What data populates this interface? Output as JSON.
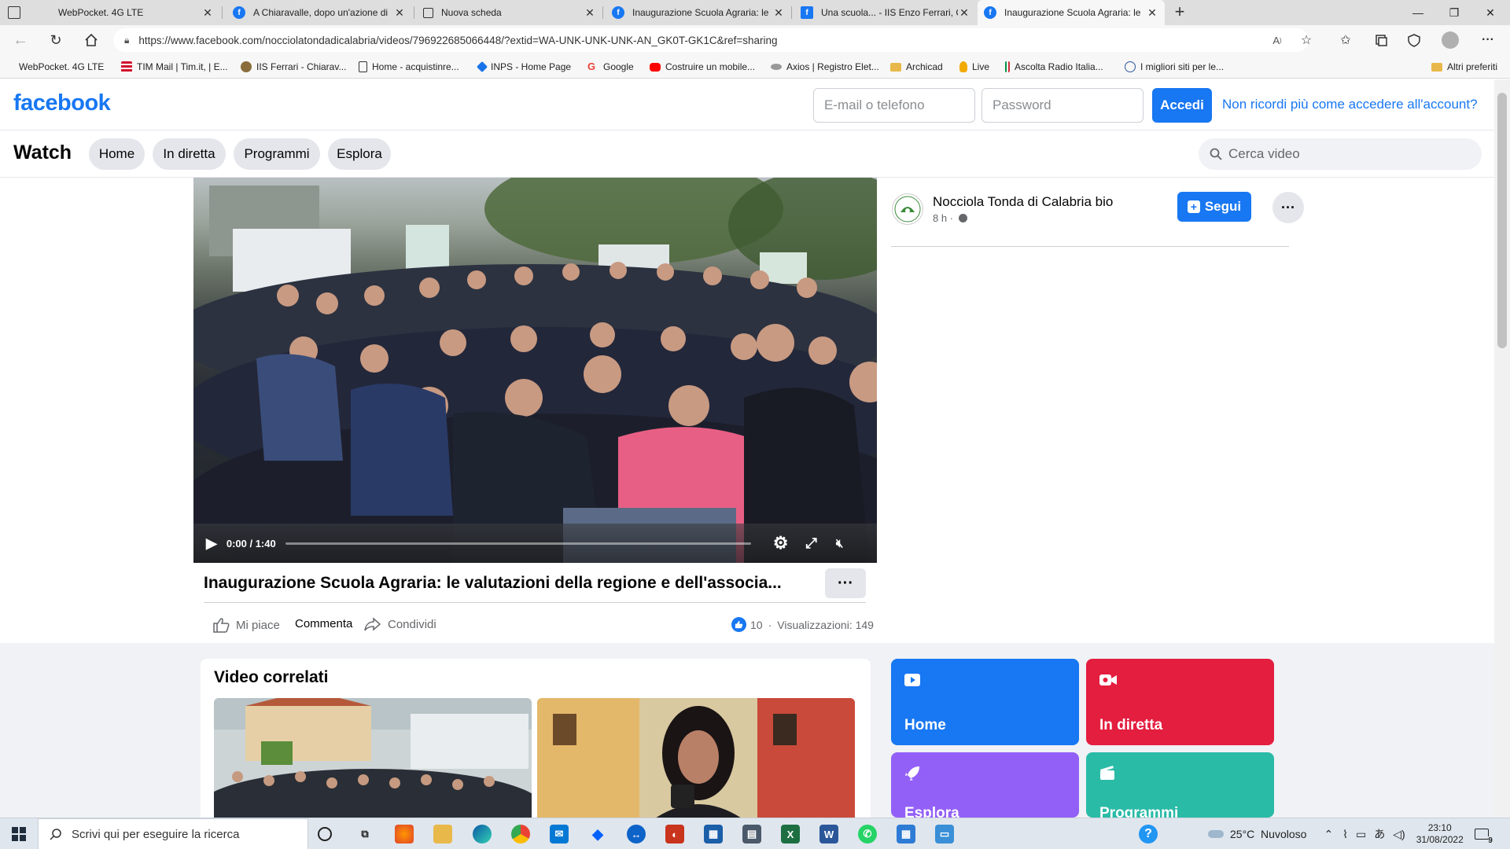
{
  "browser": {
    "tabs": [
      {
        "title": "WebPocket. 4G LTE",
        "favicon": "webpocket-icon",
        "active": false
      },
      {
        "title": "A Chiaravalle, dopo un'azione di",
        "favicon": "facebook-icon",
        "active": false
      },
      {
        "title": "Nuova scheda",
        "favicon": "new-tab-icon",
        "active": false
      },
      {
        "title": "Inaugurazione Scuola Agraria: le",
        "favicon": "facebook-icon",
        "active": false
      },
      {
        "title": "Una scuola... - IIS Enzo Ferrari, Ch",
        "favicon": "facebook-square-icon",
        "active": false
      },
      {
        "title": "Inaugurazione Scuola Agraria: le",
        "favicon": "facebook-icon",
        "active": true
      }
    ],
    "url": "https://www.facebook.com/nocciolatondadicalabria/videos/796922685066448/?extid=WA-UNK-UNK-UNK-AN_GK0T-GK1C&ref=sharing",
    "bookmarks": [
      {
        "label": "WebPocket. 4G LTE",
        "icon": "webpocket-icon",
        "color": "#7b7b7b"
      },
      {
        "label": "TIM Mail | Tim.it, | E...",
        "icon": "tim-icon",
        "color": "#d0102b"
      },
      {
        "label": "IIS Ferrari - Chiarav...",
        "icon": "school-icon",
        "color": "#8a6d3b"
      },
      {
        "label": "Home - acquistinre...",
        "icon": "page-icon",
        "color": "#ffffff"
      },
      {
        "label": "INPS - Home Page",
        "icon": "inps-icon",
        "color": "#1a73e8"
      },
      {
        "label": "Google",
        "icon": "google-icon",
        "color": "#ea4335"
      },
      {
        "label": "Costruire un mobile...",
        "icon": "youtube-icon",
        "color": "#ff0000"
      },
      {
        "label": "Axios | Registro Elet...",
        "icon": "axios-icon",
        "color": "#888888"
      },
      {
        "label": "Archicad",
        "icon": "folder-icon",
        "color": "#e8b94a"
      },
      {
        "label": "Live",
        "icon": "live-icon",
        "color": "#f2a900"
      },
      {
        "label": "Ascolta Radio Italia...",
        "icon": "radio-icon",
        "color": "#009246"
      },
      {
        "label": "I migliori siti per le...",
        "icon": "globe-icon",
        "color": "#2b579a"
      }
    ],
    "other_bookmarks": "Altri preferiti"
  },
  "fb": {
    "logo": "facebook",
    "email_placeholder": "E-mail o telefono",
    "password_placeholder": "Password",
    "login_button": "Accedi",
    "forgot_link": "Non ricordi più come accedere all'account?",
    "watch_title": "Watch",
    "watch_nav": [
      "Home",
      "In diretta",
      "Programmi",
      "Esplora"
    ],
    "search_placeholder": "Cerca video",
    "brand_color": "#1877f2"
  },
  "video": {
    "time": "0:00 / 1:40",
    "title": "Inaugurazione Scuola Agraria: le valutazioni della regione e dell'associa...",
    "more": "···",
    "actions": {
      "like": "Mi piace",
      "comment": "Commenta",
      "share": "Condividi"
    },
    "reactions_count": "10",
    "views": "Visualizzazioni: 149",
    "stats_separator": "·"
  },
  "page": {
    "name": "Nocciola Tonda di Calabria bio",
    "time": "8 h ·",
    "follow": "Segui",
    "more": "···"
  },
  "related": {
    "title": "Video correlati"
  },
  "tiles": [
    {
      "label": "Home",
      "icon": "play-icon",
      "color": "#1877f2"
    },
    {
      "label": "In diretta",
      "icon": "live-video-icon",
      "color": "#e41e3f"
    },
    {
      "label": "Esplora",
      "icon": "rocket-icon",
      "color": "#9360f7"
    },
    {
      "label": "Programmi",
      "icon": "clapper-icon",
      "color": "#2abba7"
    }
  ],
  "taskbar": {
    "search_placeholder": "Scrivi qui per eseguire la ricerca",
    "weather": "25°C  Nuvoloso",
    "time": "23:10",
    "date": "31/08/2022",
    "notifications": "9"
  }
}
